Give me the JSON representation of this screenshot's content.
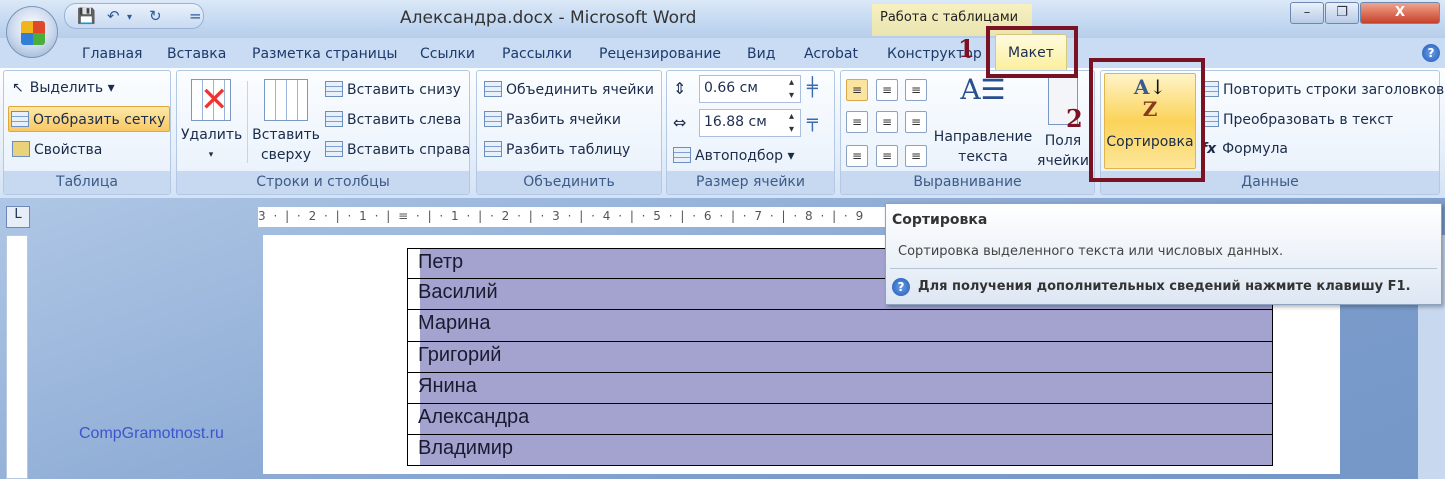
{
  "window": {
    "title": "Александра.docx - Microsoft Word",
    "context_tab_group": "Работа с таблицами",
    "minimize": "–",
    "restore": "❐",
    "close": "X"
  },
  "qat": {
    "save": "💾",
    "undo": "↶",
    "dropdown": "▾",
    "redo": "↻",
    "customize": "="
  },
  "tabs": [
    "Главная",
    "Вставка",
    "Разметка страницы",
    "Ссылки",
    "Рассылки",
    "Рецензирование",
    "Вид",
    "Acrobat",
    "Конструктор",
    "Макет"
  ],
  "help_glyph": "?",
  "groups": {
    "table": {
      "label": "Таблица",
      "select": "Выделить ▾",
      "show_grid": "Отобразить сетку",
      "properties": "Свойства"
    },
    "rows_cols": {
      "label": "Строки и столбцы",
      "delete": "Удалить",
      "delete_arrow": "▾",
      "insert_above_1": "Вставить",
      "insert_above_2": "сверху",
      "insert_below": "Вставить снизу",
      "insert_left": "Вставить слева",
      "insert_right": "Вставить справа"
    },
    "merge": {
      "label": "Объединить",
      "merge_cells": "Объединить ячейки",
      "split_cells": "Разбить ячейки",
      "split_table": "Разбить таблицу"
    },
    "cell_size": {
      "label": "Размер ячейки",
      "height": "0.66 см",
      "width": "16.88 см",
      "autofit": "Автоподбор ▾"
    },
    "alignment": {
      "label": "Выравнивание",
      "text_direction_1": "Направление",
      "text_direction_2": "текста",
      "margins_1": "Поля",
      "margins_2": "ячейки"
    },
    "data": {
      "label": "Данные",
      "sort": "Сортировка",
      "repeat_header": "Повторить строки заголовков",
      "convert_text": "Преобразовать в текст",
      "formula": "Формула"
    }
  },
  "annotations": {
    "step1": "1",
    "step2": "2"
  },
  "ruler": {
    "corner": "L",
    "text": "3 · | · 2 · | · 1 · | ≡ · | · 1 · | · 2 · | · 3 · | · 4 · | · 5 · | · 6 · | · 7 · | · 8 · | · 9"
  },
  "table_rows": [
    "Петр",
    "Василий",
    "Марина",
    "Григорий",
    "Янина",
    "Александра",
    "Владимир"
  ],
  "watermark": "CompGramotnost.ru",
  "tooltip": {
    "title": "Сортировка",
    "description": "Сортировка выделенного текста или числовых данных.",
    "help": "Для получения дополнительных сведений нажмите клавишу F1."
  },
  "colors": {
    "selection": "#a4a3d0",
    "annotation": "#7a1223",
    "active_tab": "#fbef9c"
  }
}
